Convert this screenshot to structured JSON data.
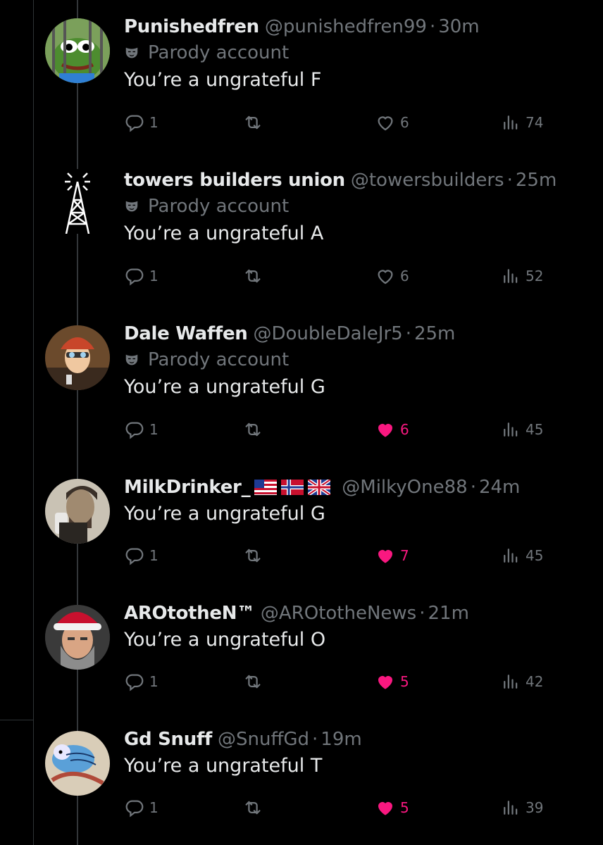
{
  "parody_label": "Parody account",
  "dot": "·",
  "colors": {
    "background": "#000000",
    "text": "#e7e9ea",
    "muted": "#71767b",
    "like": "#f91880"
  },
  "icons": {
    "reply": "reply-icon",
    "retweet": "retweet-icon",
    "like": "heart-icon",
    "views": "views-icon",
    "parody": "parody-mask-icon"
  },
  "tweets": [
    {
      "name": "Punishedfren",
      "handle": "@punishedfren99",
      "time": "30m",
      "parody": true,
      "text": "You’re a ungrateful F",
      "replies": "1",
      "likes": "6",
      "liked": false,
      "views": "74"
    },
    {
      "name": "towers builders union",
      "handle": "@towersbuilders",
      "time": "25m",
      "parody": true,
      "text": "You’re a ungrateful A",
      "replies": "1",
      "likes": "6",
      "liked": false,
      "views": "52"
    },
    {
      "name": "Dale Waffen",
      "handle": "@DoubleDaleJr5",
      "time": "25m",
      "parody": true,
      "text": "You’re a ungrateful G",
      "replies": "1",
      "likes": "6",
      "liked": true,
      "views": "45"
    },
    {
      "name": "MilkDrinker_",
      "handle": "@MilkyOne88",
      "time": "24m",
      "parody": false,
      "flags": [
        "us-flag",
        "norway-flag",
        "uk-flag"
      ],
      "text": "You’re a ungrateful G",
      "replies": "1",
      "likes": "7",
      "liked": true,
      "views": "45"
    },
    {
      "name": "AROtotheN™",
      "handle": "@AROtotheNews",
      "time": "21m",
      "parody": false,
      "text": "You’re a ungrateful O",
      "replies": "1",
      "likes": "5",
      "liked": true,
      "views": "42"
    },
    {
      "name": "Gd Snuff",
      "handle": "@SnuffGd",
      "time": "19m",
      "parody": false,
      "text": "You’re a ungrateful T",
      "replies": "1",
      "likes": "5",
      "liked": true,
      "views": "39"
    }
  ]
}
